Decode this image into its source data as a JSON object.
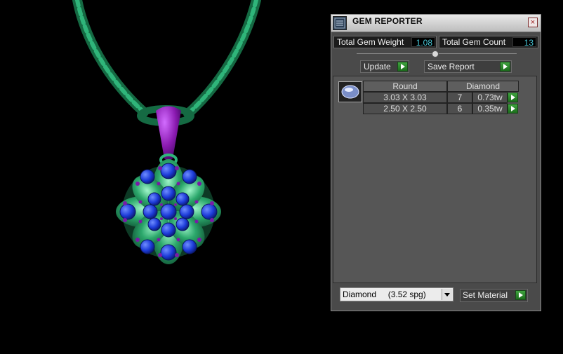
{
  "panel": {
    "title": "GEM REPORTER",
    "close_label": "×",
    "total_gem_weight_label": "Total Gem Weight",
    "total_gem_weight_value": "1.08",
    "total_gem_count_label": "Total Gem Count",
    "total_gem_count_value": "13",
    "update_label": "Update",
    "save_report_label": "Save Report",
    "table": {
      "shape_header": "Round",
      "material_header": "Diamond",
      "rows": [
        {
          "size": "3.03 X 3.03",
          "count": "7",
          "weight": "0.73tw"
        },
        {
          "size": "2.50 X 2.50",
          "count": "6",
          "weight": "0.35tw"
        }
      ]
    },
    "material_select": "Diamond     (3.52 spg)",
    "set_material_label": "Set Material"
  },
  "colors": {
    "metal_green": "#1f8f5c",
    "bail_purple": "#8a1ab0",
    "sapphire_blue": "#1c3bd8",
    "accent_green": "#2a9a2a"
  }
}
